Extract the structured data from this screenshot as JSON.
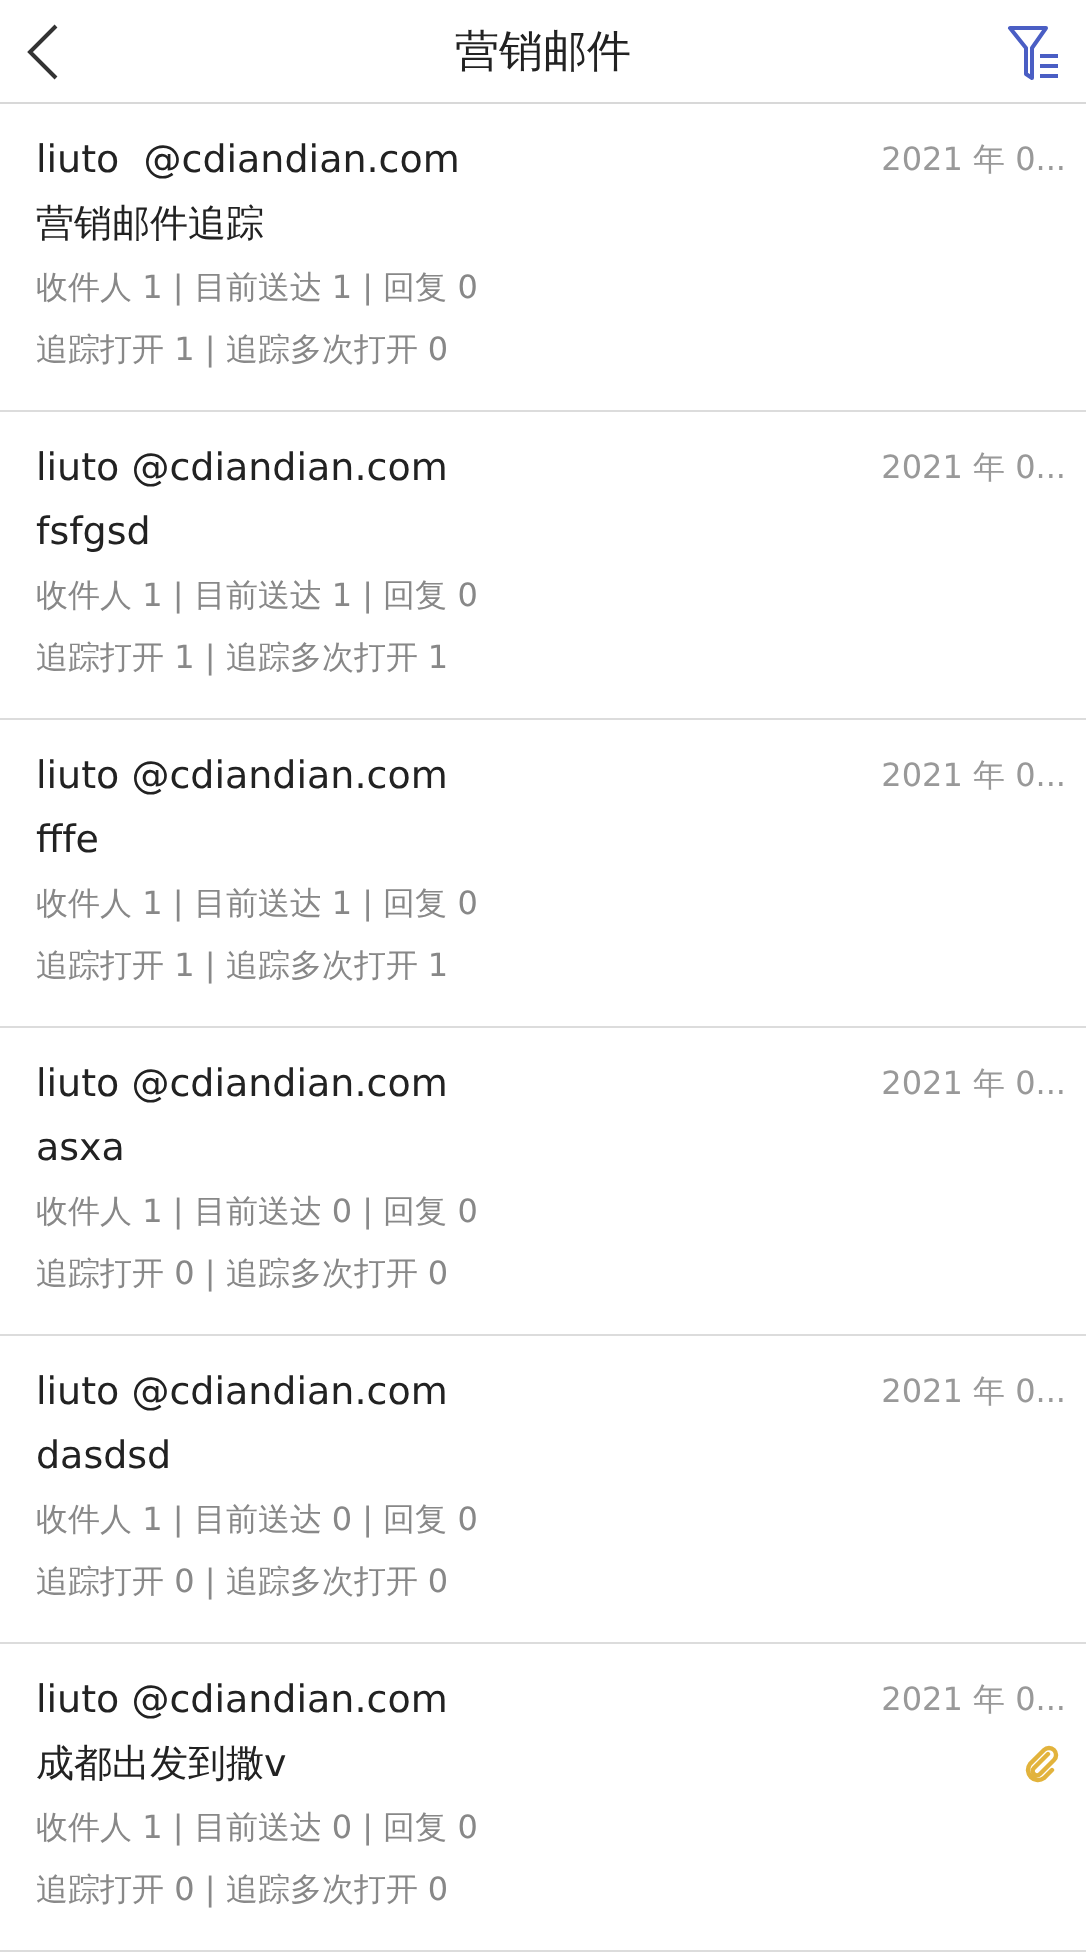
{
  "header": {
    "title": "营销邮件"
  },
  "emails": [
    {
      "sender": "liuto  @cdiandian.com",
      "date": "2021 年 0...",
      "subject": "营销邮件追踪",
      "stats": "收件人 1 | 目前送达 1 | 回复 0",
      "tracking": "追踪打开 1 | 追踪多次打开 0",
      "attachment": false
    },
    {
      "sender": "liuto @cdiandian.com",
      "date": "2021 年 0...",
      "subject": "fsfgsd",
      "stats": "收件人 1 | 目前送达 1 | 回复 0",
      "tracking": "追踪打开 1 | 追踪多次打开 1",
      "attachment": false
    },
    {
      "sender": "liuto @cdiandian.com",
      "date": "2021 年 0...",
      "subject": "fffe",
      "stats": "收件人 1 | 目前送达 1 | 回复 0",
      "tracking": "追踪打开 1 | 追踪多次打开 1",
      "attachment": false
    },
    {
      "sender": "liuto @cdiandian.com",
      "date": "2021 年 0...",
      "subject": "asxa",
      "stats": "收件人 1 | 目前送达 0 | 回复 0",
      "tracking": "追踪打开 0 | 追踪多次打开 0",
      "attachment": false
    },
    {
      "sender": "liuto @cdiandian.com",
      "date": "2021 年 0...",
      "subject": "dasdsd",
      "stats": "收件人 1 | 目前送达 0 | 回复 0",
      "tracking": "追踪打开 0 | 追踪多次打开 0",
      "attachment": false
    },
    {
      "sender": "liuto @cdiandian.com",
      "date": "2021 年 0...",
      "subject": "成都出发到撒v",
      "stats": "收件人 1 | 目前送达 0 | 回复 0",
      "tracking": "追踪打开 0 | 追踪多次打开 0",
      "attachment": true
    }
  ]
}
